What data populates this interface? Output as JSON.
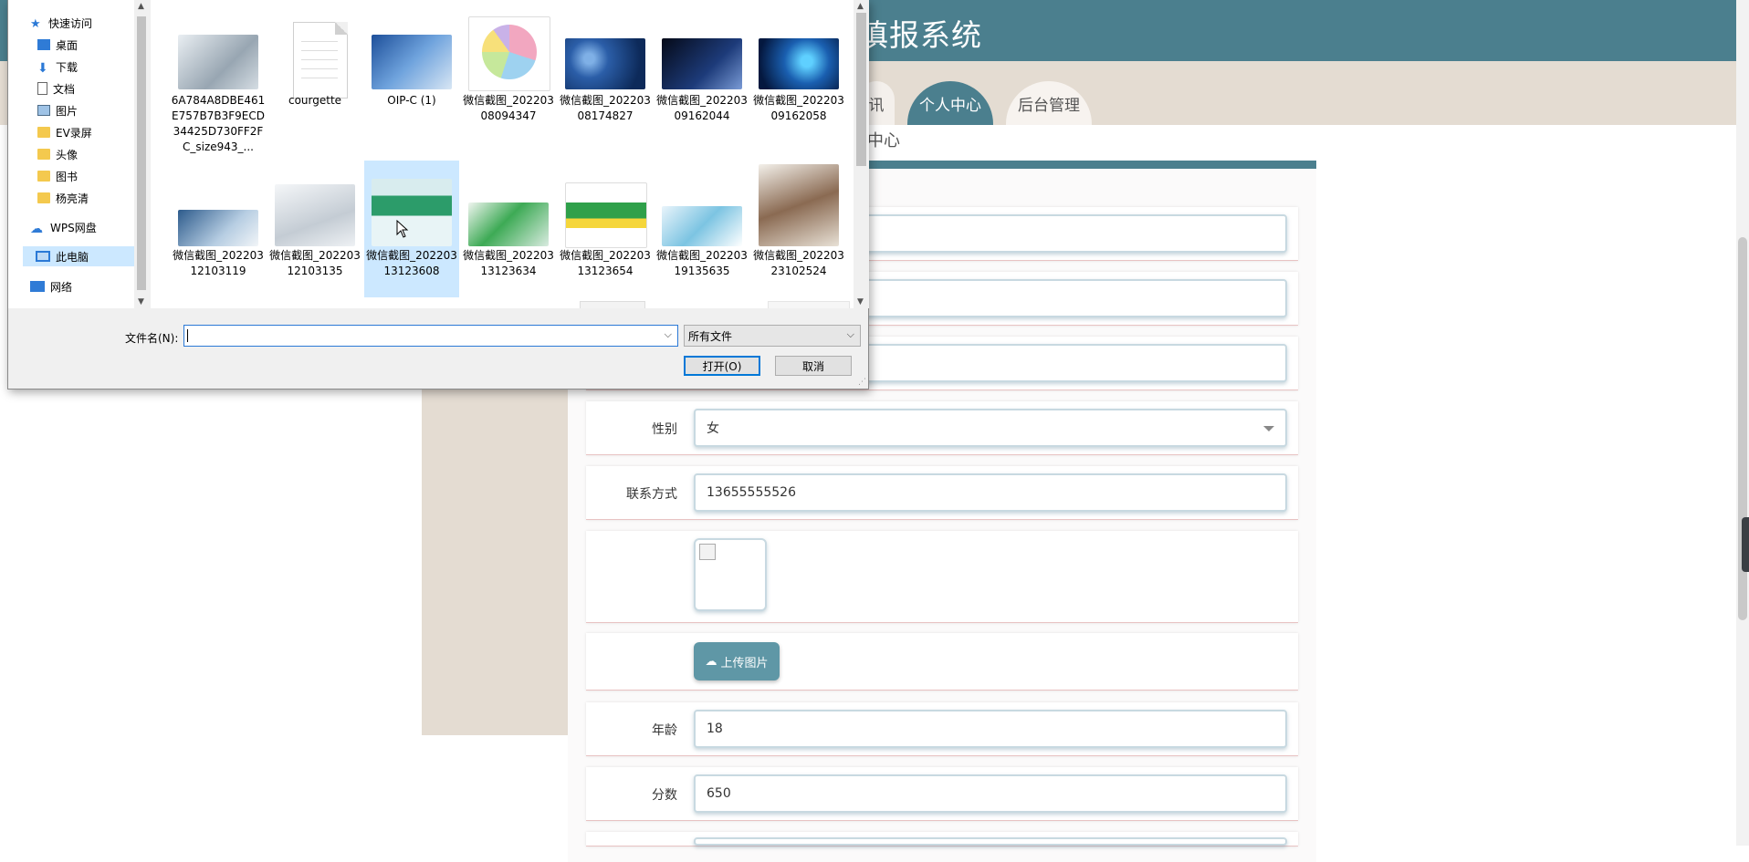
{
  "site": {
    "title": "填报系统",
    "nav": [
      {
        "label": "讯",
        "state": "partial"
      },
      {
        "label": "个人中心",
        "state": "active"
      },
      {
        "label": "后台管理",
        "state": "normal"
      }
    ],
    "section_title": "中心",
    "accent_color": "#4b7f8e"
  },
  "form": {
    "gender_label": "性别",
    "gender_value": "女",
    "contact_label": "联系方式",
    "contact_value": "13655555526",
    "upload_label": "上传图片",
    "age_label": "年龄",
    "age_value": "18",
    "score_label": "分数",
    "score_value": "650"
  },
  "dialog": {
    "nav_items": [
      {
        "label": "快速访问",
        "icon": "star-icon"
      },
      {
        "label": "桌面",
        "icon": "desktop-icon"
      },
      {
        "label": "下载",
        "icon": "download-icon"
      },
      {
        "label": "文档",
        "icon": "document-icon"
      },
      {
        "label": "图片",
        "icon": "picture-icon"
      },
      {
        "label": "EV录屏",
        "icon": "folder-icon"
      },
      {
        "label": "头像",
        "icon": "folder-icon"
      },
      {
        "label": "图书",
        "icon": "folder-icon"
      },
      {
        "label": "杨亮清",
        "icon": "folder-icon"
      },
      {
        "label": "WPS网盘",
        "icon": "cloud-icon"
      },
      {
        "label": "此电脑",
        "icon": "computer-icon"
      },
      {
        "label": "网络",
        "icon": "network-icon"
      }
    ],
    "files": [
      {
        "name": "6A784A8DBE461E757B7B3F9ECD34425D730FF2FC_size943_..."
      },
      {
        "name": "courgette"
      },
      {
        "name": "OIP-C (1)"
      },
      {
        "name": "微信截图_20220308094347"
      },
      {
        "name": "微信截图_20220308174827"
      },
      {
        "name": "微信截图_20220309162044"
      },
      {
        "name": "微信截图_20220309162058"
      },
      {
        "name": "微信截图_20220312103119"
      },
      {
        "name": "微信截图_20220312103135"
      },
      {
        "name": "微信截图_20220313123608"
      },
      {
        "name": "微信截图_20220313123634"
      },
      {
        "name": "微信截图_20220313123654"
      },
      {
        "name": "微信截图_20220319135635"
      },
      {
        "name": "微信截图_20220323102524"
      }
    ],
    "filename_label": "文件名(N):",
    "filename_value": "",
    "filetype_value": "所有文件",
    "open_label": "打开(O)",
    "cancel_label": "取消"
  }
}
